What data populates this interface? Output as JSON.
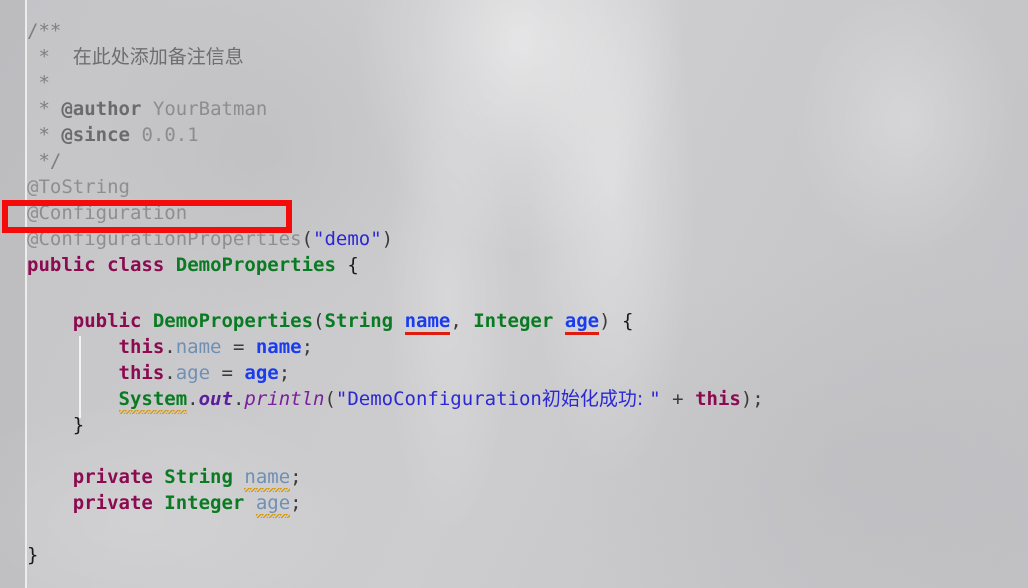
{
  "editor": {
    "language": "java",
    "class_name": "DemoProperties",
    "highlight": {
      "target_text": "@Configuration",
      "color": "#f60b0b"
    },
    "colors": {
      "background": "#c9c9cb",
      "comment": "#7f7f7f",
      "annotation": "#8e8e8e",
      "keyword": "#8b0a50",
      "type": "#0a7b22",
      "string": "#2b27d6",
      "parameter": "#1a3cf0",
      "field": "#6f8fb5",
      "method": "#7a1f9e",
      "error_underline": "#e01b10",
      "warning_underline": "#d79b12"
    }
  },
  "code": {
    "javadoc_open": "/**",
    "javadoc_star_1": " *",
    "javadoc_comment_cn": "在此处添加备注信息",
    "javadoc_star_2": " *",
    "javadoc_star_3": " *",
    "author_tag": "@author",
    "author_value": "YourBatman",
    "javadoc_star_4": " *",
    "since_tag": "@since",
    "since_value": "0.0.1",
    "javadoc_close": " */",
    "anno_tostring": "@ToString",
    "anno_configuration": "@Configuration",
    "anno_configuration_properties": "@ConfigurationProperties",
    "anno_props_open_paren": "(",
    "anno_props_arg": "\"demo\"",
    "anno_props_close_paren": ")",
    "kw_public": "public",
    "kw_class": "class",
    "class_name": "DemoProperties",
    "class_open_brace": "{",
    "ctor_kw_public": "public",
    "ctor_name": "DemoProperties",
    "ctor_open_paren": "(",
    "ctor_type_string": "String",
    "ctor_param_name": "name",
    "ctor_comma": ", ",
    "ctor_type_integer": "Integer",
    "ctor_param_age": "age",
    "ctor_close_paren": ")",
    "ctor_open_brace": "{",
    "kw_this_1": "this",
    "dot": ".",
    "field_name_1": "name",
    "assign": " = ",
    "param_ref_name": "name",
    "semi": ";",
    "kw_this_2": "this",
    "field_age_1": "age",
    "param_ref_age": "age",
    "sys_system": "System",
    "sys_out": "out",
    "sys_println": "println",
    "print_open_paren": "(",
    "print_str_prefix": "\"DemoConfiguration",
    "print_str_cn": "初始化成功: ",
    "print_str_close_quote": "\"",
    "print_plus": " + ",
    "print_this": "this",
    "print_close_paren": ")",
    "ctor_close_brace": "}",
    "field_kw_private_1": "private",
    "field_type_string": "String",
    "field_decl_name": "name",
    "field_kw_private_2": "private",
    "field_type_integer": "Integer",
    "field_decl_age": "age",
    "class_close_brace": "}"
  }
}
